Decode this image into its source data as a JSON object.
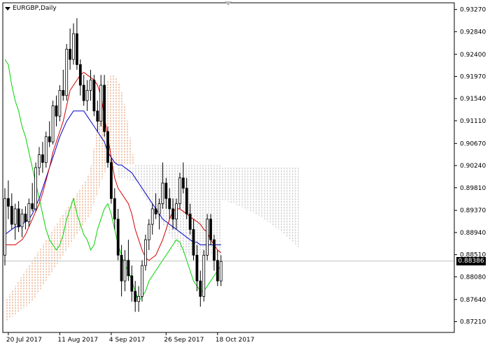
{
  "chart_data": {
    "type": "candlestick",
    "title": "EURGBP,Daily",
    "ylim": [
      0.87,
      0.934
    ],
    "y_ticks": [
      "0.93270",
      "0.92840",
      "0.92400",
      "0.91970",
      "0.91540",
      "0.91110",
      "0.90670",
      "0.90240",
      "0.89810",
      "0.89370",
      "0.88940",
      "0.88510",
      "0.88080",
      "0.87640",
      "0.87210"
    ],
    "x_labels": [
      {
        "i": 1,
        "label": "20 Jul 2017"
      },
      {
        "i": 16,
        "label": "11 Aug 2017"
      },
      {
        "i": 31,
        "label": "4 Sep 2017"
      },
      {
        "i": 47,
        "label": "26 Sep 2017"
      },
      {
        "i": 62,
        "label": "18 Oct 2017"
      }
    ],
    "current_price": "0.88386",
    "candles": [
      [
        0.885,
        0.898,
        0.883,
        0.896
      ],
      [
        0.896,
        0.8995,
        0.892,
        0.8945
      ],
      [
        0.8945,
        0.897,
        0.89,
        0.891
      ],
      [
        0.891,
        0.895,
        0.888,
        0.894
      ],
      [
        0.894,
        0.8955,
        0.8895,
        0.8905
      ],
      [
        0.8905,
        0.894,
        0.8885,
        0.893
      ],
      [
        0.893,
        0.8945,
        0.89,
        0.8915
      ],
      [
        0.8915,
        0.896,
        0.8905,
        0.895
      ],
      [
        0.895,
        0.899,
        0.8935,
        0.894
      ],
      [
        0.894,
        0.903,
        0.8935,
        0.902
      ],
      [
        0.902,
        0.906,
        0.9005,
        0.9045
      ],
      [
        0.9045,
        0.907,
        0.901,
        0.903
      ],
      [
        0.903,
        0.909,
        0.902,
        0.908
      ],
      [
        0.908,
        0.911,
        0.906,
        0.907
      ],
      [
        0.907,
        0.915,
        0.9065,
        0.914
      ],
      [
        0.914,
        0.916,
        0.91,
        0.912
      ],
      [
        0.912,
        0.918,
        0.911,
        0.917
      ],
      [
        0.917,
        0.921,
        0.915,
        0.916
      ],
      [
        0.916,
        0.926,
        0.915,
        0.925
      ],
      [
        0.925,
        0.929,
        0.921,
        0.923
      ],
      [
        0.923,
        0.93,
        0.922,
        0.928
      ],
      [
        0.928,
        0.931,
        0.921,
        0.922
      ],
      [
        0.922,
        0.923,
        0.916,
        0.918
      ],
      [
        0.918,
        0.92,
        0.914,
        0.915
      ],
      [
        0.915,
        0.919,
        0.913,
        0.917
      ],
      [
        0.917,
        0.921,
        0.915,
        0.919
      ],
      [
        0.919,
        0.92,
        0.912,
        0.913
      ],
      [
        0.913,
        0.915,
        0.909,
        0.911
      ],
      [
        0.911,
        0.92,
        0.91,
        0.918
      ],
      [
        0.918,
        0.92,
        0.908,
        0.909
      ],
      [
        0.909,
        0.91,
        0.902,
        0.903
      ],
      [
        0.903,
        0.904,
        0.895,
        0.896
      ],
      [
        0.896,
        0.898,
        0.89,
        0.892
      ],
      [
        0.892,
        0.894,
        0.884,
        0.885
      ],
      [
        0.885,
        0.887,
        0.877,
        0.88
      ],
      [
        0.88,
        0.886,
        0.878,
        0.884
      ],
      [
        0.884,
        0.888,
        0.88,
        0.881
      ],
      [
        0.881,
        0.883,
        0.876,
        0.878
      ],
      [
        0.878,
        0.88,
        0.874,
        0.876
      ],
      [
        0.876,
        0.879,
        0.874,
        0.877
      ],
      [
        0.877,
        0.884,
        0.876,
        0.883
      ],
      [
        0.883,
        0.889,
        0.882,
        0.888
      ],
      [
        0.888,
        0.892,
        0.886,
        0.891
      ],
      [
        0.891,
        0.895,
        0.889,
        0.894
      ],
      [
        0.894,
        0.897,
        0.892,
        0.893
      ],
      [
        0.893,
        0.896,
        0.89,
        0.895
      ],
      [
        0.895,
        0.903,
        0.894,
        0.899
      ],
      [
        0.899,
        0.9,
        0.894,
        0.896
      ],
      [
        0.896,
        0.898,
        0.892,
        0.894
      ],
      [
        0.894,
        0.896,
        0.89,
        0.892
      ],
      [
        0.892,
        0.896,
        0.89,
        0.895
      ],
      [
        0.895,
        0.901,
        0.894,
        0.9
      ],
      [
        0.9,
        0.903,
        0.897,
        0.898
      ],
      [
        0.898,
        0.9,
        0.892,
        0.893
      ],
      [
        0.893,
        0.895,
        0.889,
        0.89
      ],
      [
        0.89,
        0.892,
        0.884,
        0.885
      ],
      [
        0.885,
        0.887,
        0.878,
        0.88
      ],
      [
        0.88,
        0.882,
        0.875,
        0.877
      ],
      [
        0.877,
        0.886,
        0.876,
        0.885
      ],
      [
        0.885,
        0.893,
        0.884,
        0.892
      ],
      [
        0.892,
        0.893,
        0.887,
        0.888
      ],
      [
        0.888,
        0.889,
        0.882,
        0.884
      ],
      [
        0.884,
        0.886,
        0.879,
        0.88
      ],
      [
        0.88,
        0.885,
        0.879,
        0.8838
      ]
    ],
    "series": [
      {
        "values": [
          0.887,
          0.887,
          0.887,
          0.887,
          0.8875,
          0.888,
          0.889,
          0.8905,
          0.892,
          0.8935,
          0.895,
          0.897,
          0.8995,
          0.902,
          0.905,
          0.907,
          0.909,
          0.911,
          0.914,
          0.917,
          0.918,
          0.919,
          0.92,
          0.9205,
          0.92,
          0.9195,
          0.919,
          0.918,
          0.916,
          0.912,
          0.908,
          0.904,
          0.9,
          0.898,
          0.897,
          0.896,
          0.895,
          0.893,
          0.89,
          0.888,
          0.886,
          0.8845,
          0.884,
          0.8845,
          0.885,
          0.8865,
          0.888,
          0.89,
          0.892,
          0.8935,
          0.894,
          0.894,
          0.8935,
          0.893,
          0.8925,
          0.892,
          0.8915,
          0.891,
          0.89,
          0.8895,
          0.888,
          0.887,
          0.886,
          0.8855
        ]
      },
      {
        "values": [
          0.889,
          0.8895,
          0.89,
          0.8905,
          0.8905,
          0.891,
          0.8915,
          0.892,
          0.893,
          0.8945,
          0.896,
          0.898,
          0.9,
          0.902,
          0.904,
          0.906,
          0.908,
          0.9095,
          0.911,
          0.912,
          0.913,
          0.913,
          0.913,
          0.913,
          0.912,
          0.911,
          0.91,
          0.909,
          0.908,
          0.907,
          0.905,
          0.904,
          0.903,
          0.9025,
          0.9025,
          0.902,
          0.9015,
          0.901,
          0.9,
          0.899,
          0.898,
          0.897,
          0.896,
          0.895,
          0.894,
          0.893,
          0.892,
          0.8915,
          0.891,
          0.8905,
          0.89,
          0.8895,
          0.889,
          0.8885,
          0.888,
          0.8875,
          0.8875,
          0.887,
          0.887,
          0.887,
          0.887,
          0.887,
          0.887,
          0.887
        ]
      },
      {
        "values": [
          0.923,
          0.922,
          0.918,
          0.915,
          0.913,
          0.91,
          0.908,
          0.905,
          0.902,
          0.899,
          0.896,
          0.893,
          0.89,
          0.888,
          0.887,
          0.886,
          0.887,
          0.889,
          0.892,
          0.894,
          0.896,
          0.893,
          0.891,
          0.889,
          0.888,
          0.886,
          0.887,
          0.89,
          0.892,
          0.894,
          0.895,
          0.893,
          0.89,
          0.887,
          0.885,
          0.883,
          0.882,
          0.88,
          0.878,
          0.876,
          0.877,
          0.878,
          0.88,
          0.881,
          0.882,
          0.883,
          0.884,
          0.885,
          0.886,
          0.887,
          0.888,
          0.8875,
          0.886,
          0.884,
          0.882,
          0.88,
          0.879,
          0.878,
          0.878,
          0.879,
          0.88,
          0.881,
          0.882,
          0.883
        ]
      },
      {
        "span_a": [
          0.876,
          0.877,
          0.878,
          0.879,
          0.88,
          0.881,
          0.882,
          0.883,
          0.884,
          0.885,
          0.886,
          0.887,
          0.888,
          0.889,
          0.89,
          0.891,
          0.892,
          0.893,
          0.894,
          0.895,
          0.896,
          0.897,
          0.898,
          0.899,
          0.9,
          0.902,
          0.906,
          0.91,
          0.914,
          0.917,
          0.919,
          0.92,
          0.92,
          0.919,
          0.917,
          0.914,
          0.91,
          0.906,
          0.902,
          0.899,
          0.897,
          0.896,
          0.895,
          0.894,
          0.893,
          0.892,
          0.891,
          0.89,
          0.889,
          0.888,
          0.887,
          0.886,
          0.8855,
          0.885,
          0.885,
          0.885,
          0.885,
          0.885,
          0.885,
          0.885,
          0.885,
          0.885,
          0.885,
          0.885
        ],
        "span_b": [
          0.872,
          0.8725,
          0.873,
          0.8735,
          0.874,
          0.8745,
          0.875,
          0.8755,
          0.876,
          0.877,
          0.878,
          0.879,
          0.88,
          0.881,
          0.882,
          0.883,
          0.884,
          0.885,
          0.886,
          0.887,
          0.888,
          0.889,
          0.89,
          0.891,
          0.892,
          0.893,
          0.895,
          0.897,
          0.899,
          0.901,
          0.902,
          0.9025,
          0.9025,
          0.9025,
          0.9025,
          0.9025,
          0.9025,
          0.9025,
          0.9025,
          0.9025,
          0.9025,
          0.9025,
          0.9025,
          0.9025,
          0.9025,
          0.9025,
          0.9025,
          0.9025,
          0.9025,
          0.9025,
          0.9025,
          0.9025,
          0.9025,
          0.9025,
          0.9025,
          0.9025,
          0.9025,
          0.9025,
          0.9025,
          0.9025,
          0.9025,
          0.9025,
          0.9025,
          0.9025
        ]
      }
    ],
    "colors": {
      "candle": "#000000",
      "tenkan": "#d40000",
      "kijun": "#0000c8",
      "chikou": "#00d400",
      "kumo_bull": "#e39a6c",
      "kumo_bear": "#b8b8b8",
      "grid": "#c0c0c0",
      "price_line": "#c0c0c0",
      "price_tag_bg": "#000000",
      "price_tag_text": "#ffffff"
    }
  }
}
